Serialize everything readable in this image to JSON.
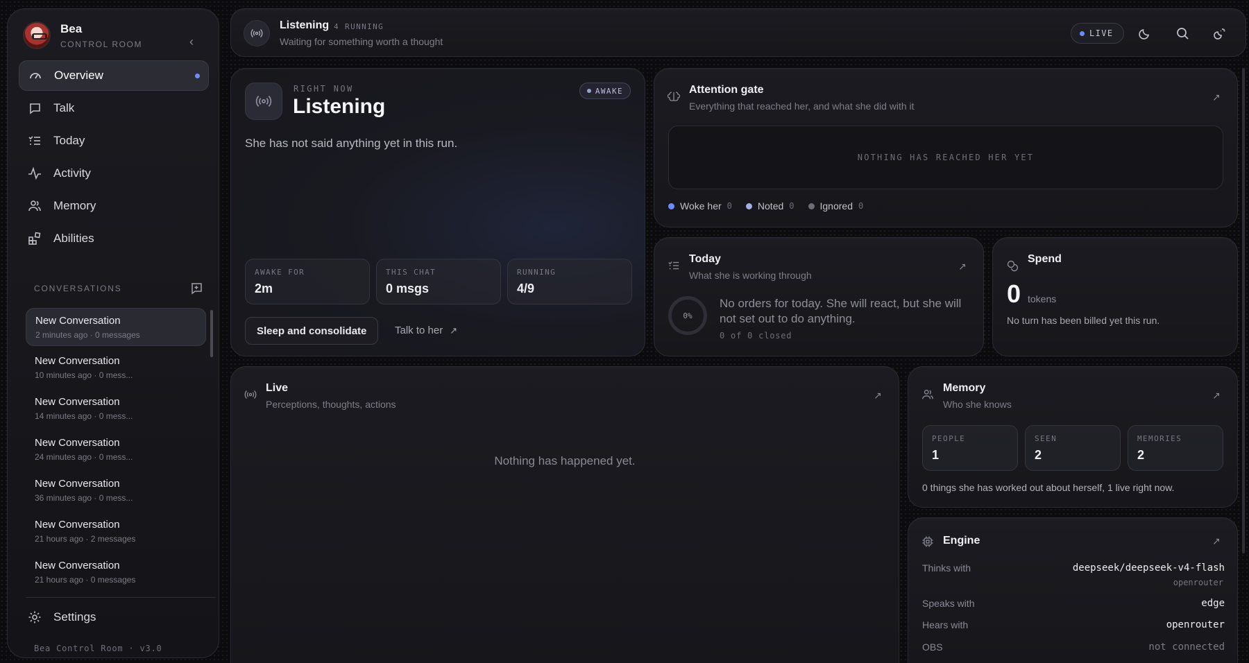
{
  "sidebar": {
    "brand_name": "Bea",
    "brand_sub": "CONTROL ROOM",
    "nav": [
      {
        "label": "Overview",
        "icon": "gauge-icon",
        "active": true
      },
      {
        "label": "Talk",
        "icon": "chat-icon"
      },
      {
        "label": "Today",
        "icon": "checklist-icon"
      },
      {
        "label": "Activity",
        "icon": "pulse-icon"
      },
      {
        "label": "Memory",
        "icon": "people-icon"
      },
      {
        "label": "Abilities",
        "icon": "blocks-icon"
      }
    ],
    "conversations_heading": "CONVERSATIONS",
    "conversations": [
      {
        "title": "New Conversation",
        "meta": "2 minutes ago · 0 messages"
      },
      {
        "title": "New Conversation",
        "meta": "10 minutes ago · 0 mess..."
      },
      {
        "title": "New Conversation",
        "meta": "14 minutes ago · 0 mess..."
      },
      {
        "title": "New Conversation",
        "meta": "24 minutes ago · 0 mess..."
      },
      {
        "title": "New Conversation",
        "meta": "36 minutes ago · 0 mess..."
      },
      {
        "title": "New Conversation",
        "meta": "21 hours ago · 2 messages"
      },
      {
        "title": "New Conversation",
        "meta": "21 hours ago · 0 messages"
      }
    ],
    "settings_label": "Settings",
    "version": "Bea Control Room · v3.0"
  },
  "topbar": {
    "title": "Listening",
    "running": "4 RUNNING",
    "subtitle": "Waiting for something worth a thought",
    "live_label": "LIVE"
  },
  "right_now": {
    "kicker": "RIGHT NOW",
    "title": "Listening",
    "state_badge": "AWAKE",
    "text": "She has not said anything yet in this run.",
    "stats": [
      {
        "label": "AWAKE FOR",
        "value": "2m"
      },
      {
        "label": "THIS CHAT",
        "value": "0 msgs"
      },
      {
        "label": "RUNNING",
        "value": "4/9"
      }
    ],
    "sleep_button": "Sleep and consolidate",
    "talk_link": "Talk to her"
  },
  "attention": {
    "title": "Attention gate",
    "subtitle": "Everything that reached her, and what she did with it",
    "empty": "NOTHING HAS REACHED HER YET",
    "legend": [
      {
        "label": "Woke her",
        "count": "0",
        "color": "#6d8bff"
      },
      {
        "label": "Noted",
        "count": "0",
        "color": "#a4aee0"
      },
      {
        "label": "Ignored",
        "count": "0",
        "color": "#6d6d78"
      }
    ]
  },
  "today": {
    "title": "Today",
    "subtitle": "What she is working through",
    "progress_label": "0%",
    "progress": 0,
    "text": "No orders for today. She will react, but she will not set out to do anything.",
    "closed": "0 of 0 closed"
  },
  "spend": {
    "title": "Spend",
    "value": "0",
    "unit": "tokens",
    "note": "No turn has been billed yet this run."
  },
  "live": {
    "title": "Live",
    "subtitle": "Perceptions, thoughts, actions",
    "empty": "Nothing has happened yet."
  },
  "memory": {
    "title": "Memory",
    "subtitle": "Who she knows",
    "stats": [
      {
        "label": "PEOPLE",
        "value": "1"
      },
      {
        "label": "SEEN",
        "value": "2"
      },
      {
        "label": "MEMORIES",
        "value": "2"
      }
    ],
    "note": "0 things she has worked out about herself, 1 live right now."
  },
  "engine": {
    "title": "Engine",
    "rows": [
      {
        "key": "Thinks with",
        "value": "deepseek/deepseek-v4-flash",
        "sub": "openrouter"
      },
      {
        "key": "Speaks with",
        "value": "edge"
      },
      {
        "key": "Hears with",
        "value": "openrouter"
      },
      {
        "key": "OBS",
        "value": "not connected"
      }
    ]
  },
  "colors": {
    "accent": "#6d8bff",
    "background": "#0c0c0f",
    "card": "#1a1a20"
  }
}
